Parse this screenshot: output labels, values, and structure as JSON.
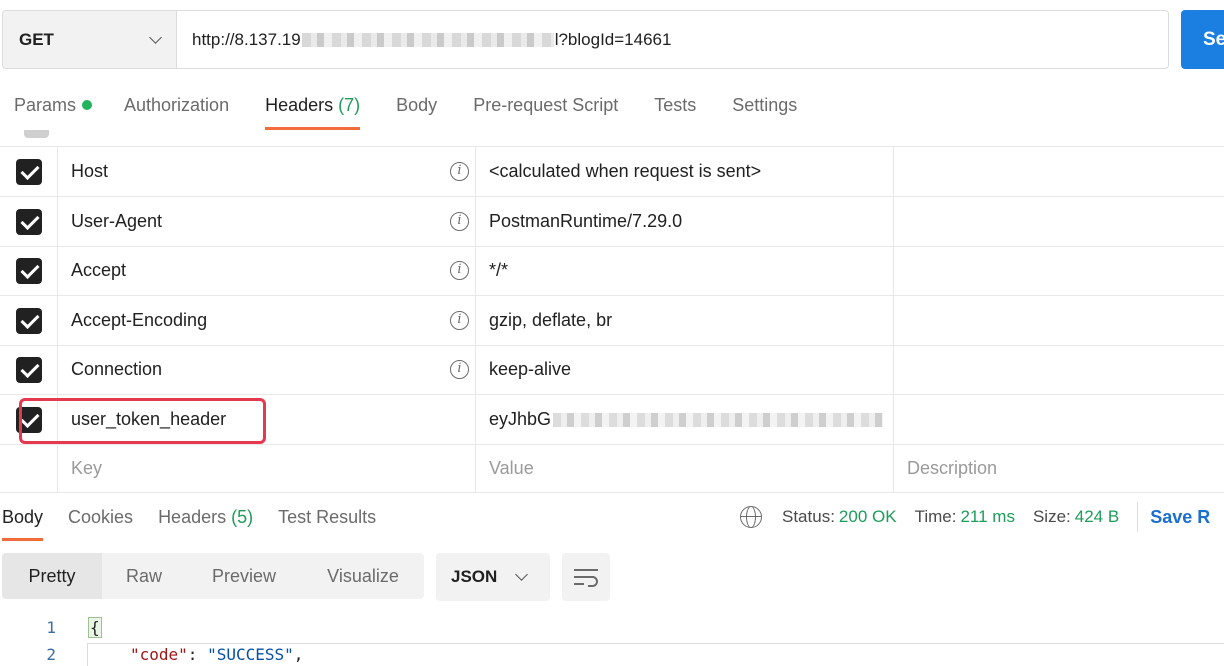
{
  "request": {
    "method": "GET",
    "url_prefix": "http://8.137.19",
    "url_suffix": "l?blogId=14661",
    "send_label": "Se"
  },
  "request_tabs": [
    {
      "label": "Params",
      "dot": true
    },
    {
      "label": "Authorization"
    },
    {
      "label": "Headers",
      "count": "(7)",
      "active": true
    },
    {
      "label": "Body"
    },
    {
      "label": "Pre-request Script"
    },
    {
      "label": "Tests"
    },
    {
      "label": "Settings"
    }
  ],
  "headers": [
    {
      "key": "Host",
      "value": "<calculated when request is sent>",
      "checked": true
    },
    {
      "key": "User-Agent",
      "value": "PostmanRuntime/7.29.0",
      "checked": true
    },
    {
      "key": "Accept",
      "value": "*/*",
      "checked": true
    },
    {
      "key": "Accept-Encoding",
      "value": "gzip, deflate, br",
      "checked": true
    },
    {
      "key": "Connection",
      "value": "keep-alive",
      "checked": true
    },
    {
      "key": "user_token_header",
      "value": "eyJhbG",
      "checked": true
    }
  ],
  "new_row": {
    "key_placeholder": "Key",
    "value_placeholder": "Value",
    "description_placeholder": "Description"
  },
  "info_glyph": "i",
  "response_tabs": [
    {
      "label": "Body",
      "active": true
    },
    {
      "label": "Cookies"
    },
    {
      "label": "Headers",
      "count": "(5)"
    },
    {
      "label": "Test Results"
    }
  ],
  "status": {
    "status_label": "Status:",
    "status_value": "200 OK",
    "time_label": "Time:",
    "time_value": "211 ms",
    "size_label": "Size:",
    "size_value": "424 B",
    "save_label": "Save R"
  },
  "body_views": [
    "Pretty",
    "Raw",
    "Preview",
    "Visualize"
  ],
  "format": "JSON",
  "code_lines": [
    {
      "num": "1",
      "text": "{"
    },
    {
      "num": "2",
      "key": "\"code\"",
      "sep": ": ",
      "value": "\"SUCCESS\"",
      "tail": ","
    }
  ],
  "colors": {
    "accent": "#f26b3a",
    "send": "#1a7fe0",
    "success": "#1e9d5a",
    "highlight": "#e63950"
  }
}
